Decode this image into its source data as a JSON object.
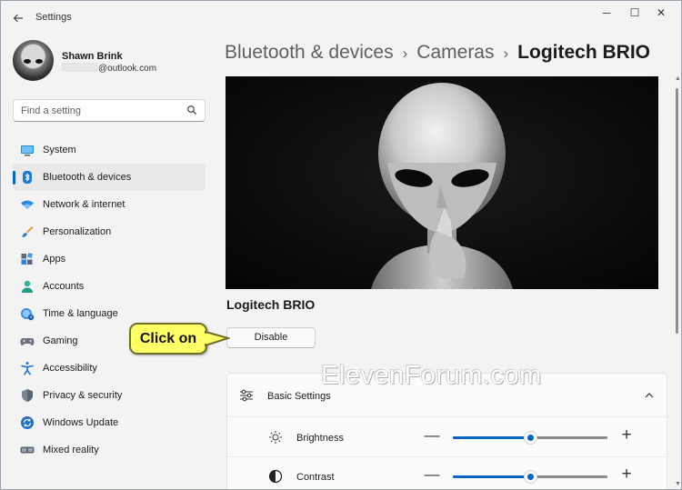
{
  "window": {
    "app_title": "Settings",
    "back_icon": "arrow-left-icon",
    "controls": {
      "minimize": "─",
      "maximize": "☐",
      "close": "✕"
    }
  },
  "profile": {
    "name": "Shawn Brink",
    "email_suffix": "@outlook.com"
  },
  "search": {
    "placeholder": "Find a setting"
  },
  "nav": {
    "items": [
      {
        "label": "System",
        "icon": "monitor-icon",
        "active": false
      },
      {
        "label": "Bluetooth & devices",
        "icon": "bluetooth-icon",
        "active": true
      },
      {
        "label": "Network & internet",
        "icon": "wifi-icon",
        "active": false
      },
      {
        "label": "Personalization",
        "icon": "paintbrush-icon",
        "active": false
      },
      {
        "label": "Apps",
        "icon": "apps-icon",
        "active": false
      },
      {
        "label": "Accounts",
        "icon": "person-icon",
        "active": false
      },
      {
        "label": "Time & language",
        "icon": "globe-clock-icon",
        "active": false
      },
      {
        "label": "Gaming",
        "icon": "gamepad-icon",
        "active": false
      },
      {
        "label": "Accessibility",
        "icon": "accessibility-icon",
        "active": false
      },
      {
        "label": "Privacy & security",
        "icon": "shield-icon",
        "active": false
      },
      {
        "label": "Windows Update",
        "icon": "update-icon",
        "active": false
      },
      {
        "label": "Mixed reality",
        "icon": "vr-headset-icon",
        "active": false
      }
    ]
  },
  "breadcrumb": {
    "items": [
      "Bluetooth & devices",
      "Cameras"
    ],
    "separator": "›",
    "current": "Logitech BRIO"
  },
  "camera": {
    "name": "Logitech BRIO",
    "disable_label": "Disable"
  },
  "callout": {
    "text": "Click on"
  },
  "basic_settings": {
    "title": "Basic Settings",
    "rows": [
      {
        "label": "Brightness",
        "icon": "sun-icon",
        "value_fraction": 0.5,
        "minus": "—",
        "plus": "+"
      },
      {
        "label": "Contrast",
        "icon": "contrast-icon",
        "value_fraction": 0.5,
        "minus": "—",
        "plus": "+"
      }
    ]
  },
  "watermark": "ElevenForum.com",
  "colors": {
    "accent": "#0067c0",
    "window_bg": "#f3f3f3",
    "callout_bg": "#ffff66"
  }
}
